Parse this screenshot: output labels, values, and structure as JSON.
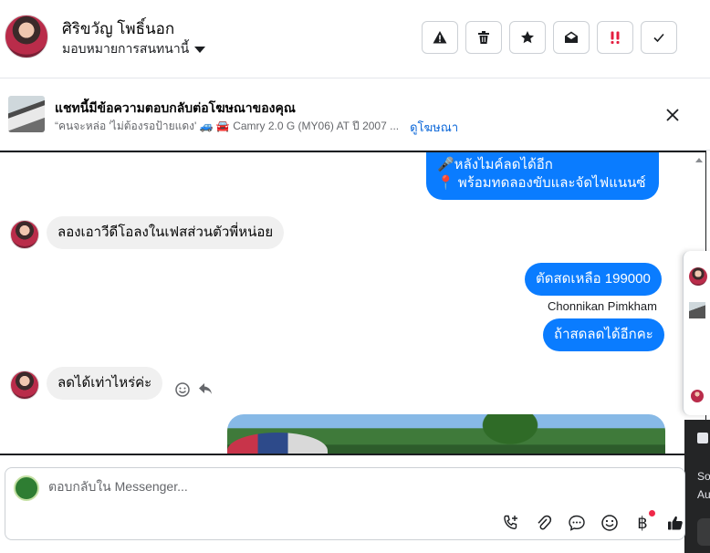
{
  "header": {
    "contact_name": "ศิริขวัญ โพธิ์นอก",
    "assign_label": "มอบหมายการสนทนานี้",
    "actions": [
      {
        "icon": "warning-icon",
        "color": "#1c1e21"
      },
      {
        "icon": "trash-icon",
        "color": "#1c1e21"
      },
      {
        "icon": "star-icon",
        "color": "#1c1e21"
      },
      {
        "icon": "envelope-open-icon",
        "color": "#1c1e21"
      },
      {
        "icon": "double-exclamation-icon",
        "color": "#e41e3f"
      },
      {
        "icon": "check-icon",
        "color": "#1c1e21"
      }
    ]
  },
  "ad_banner": {
    "title": "แชทนี้มีข้อความตอบกลับต่อโฆษณาของคุณ",
    "subtitle": "“คนจะหล่อ 'ไม่ต้องรอป้ายแดง' 🚙 🚘 Camry 2.0 G (MY06) AT ปี 2007 ...",
    "link": "ดูโฆษณา"
  },
  "messages": {
    "m1_line1": "🎤หลังไมค์ลดได้อีก",
    "m1_line2": "📍 พร้อมทดลองขับและจัดไฟแนนซ์",
    "m2": "ลองเอาวีดีโอลงในเฟสส่วนตัวพี่หน่อย",
    "m3": "ตัดสดเหลือ 199000",
    "sender": "Chonnikan Pimkham",
    "m4": "ถ้าสดลดได้อีกคะ",
    "m5": "ลดได้เท่าไหร่ค่ะ"
  },
  "side_panel": {
    "text_line1": "So",
    "text_line2": "Au"
  },
  "composer": {
    "placeholder": "ตอบกลับใน Messenger..."
  },
  "colors": {
    "outgoing_bubble": "#0a7cff",
    "incoming_bubble": "#f0f0f0",
    "link": "#0a66d8"
  }
}
